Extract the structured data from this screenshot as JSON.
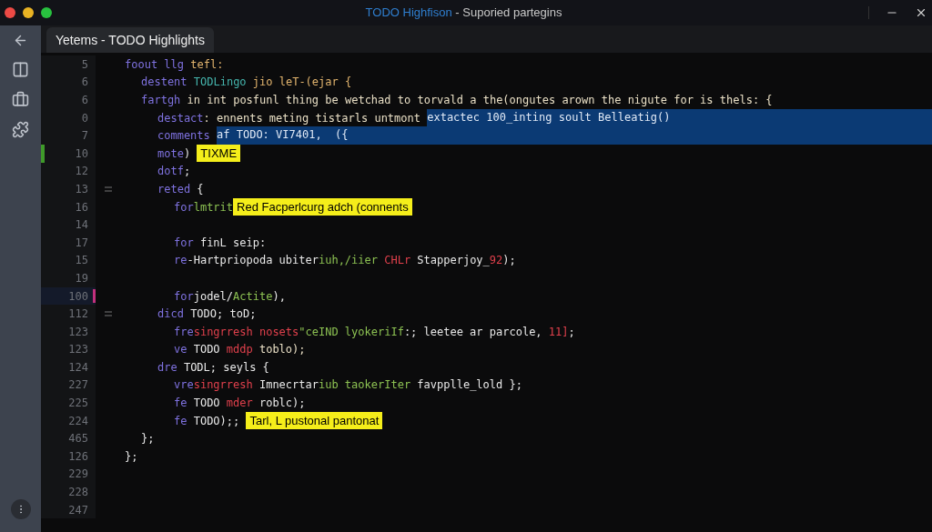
{
  "window": {
    "title_app": "TODO Highfison",
    "title_rest": " - Suporied partegins"
  },
  "tab": {
    "label": "Yetems - TODO Highlights",
    "selected": true
  },
  "lines": [
    {
      "number": "5",
      "fold": false,
      "added": false,
      "current": false,
      "segments": [
        {
          "kind": "keyword",
          "text": "foout llg"
        },
        {
          "kind": "orange",
          "text": " tefl:"
        }
      ],
      "children": [
        {
          "number": "6",
          "fold": false,
          "added": false,
          "current": false,
          "segments": [
            {
              "kind": "keyword",
              "text": "destent "
            },
            {
              "kind": "func",
              "text": "TODLingo"
            },
            {
              "kind": "orange",
              "text": " jio leT-(ejar {"
            }
          ]
        },
        {
          "number": "6",
          "fold": false,
          "added": false,
          "current": false,
          "segments": [
            {
              "kind": "keyword",
              "text": "fartgh"
            },
            {
              "kind": "beige",
              "text": " in int posfunl thing be wetchad to torvald a the(ongutes arown the nigute for is thels: {"
            }
          ],
          "children": [
            {
              "number": "0",
              "fold": false,
              "added": false,
              "current": false,
              "segments": [
                {
                  "kind": "keyword",
                  "text": "destact"
                },
                {
                  "kind": "beige",
                  "text": ": ennents meting tistarls untmont "
                },
                {
                  "kind": "selection",
                  "text": "extactec 100_inting soult Belleatig()"
                }
              ]
            },
            {
              "number": "7",
              "fold": false,
              "added": false,
              "current": false,
              "segments": [
                {
                  "kind": "keyword",
                  "text": "comments "
                },
                {
                  "kind": "selection",
                  "text": "af TODO: VI7401,  ({"
                }
              ]
            },
            {
              "number": "10",
              "fold": false,
              "added": true,
              "current": false,
              "segments": [
                {
                  "kind": "keyword",
                  "text": "mote"
                },
                {
                  "kind": "plain",
                  "text": ") "
                },
                {
                  "kind": "highlight",
                  "text": "TIXME"
                }
              ]
            },
            {
              "number": "12",
              "fold": false,
              "added": false,
              "current": false,
              "segments": [
                {
                  "kind": "keyword",
                  "text": "dotf"
                },
                {
                  "kind": "plain",
                  "text": ";"
                }
              ]
            },
            {
              "number": "13",
              "fold": true,
              "added": false,
              "current": false,
              "segments": [
                {
                  "kind": "keyword",
                  "text": "reted"
                },
                {
                  "kind": "plain",
                  "text": " {"
                }
              ],
              "children": [
                {
                  "number": "16",
                  "fold": false,
                  "added": false,
                  "current": false,
                  "segments": [
                    {
                      "kind": "keyword",
                      "text": "for"
                    },
                    {
                      "kind": "type",
                      "text": "lmtrit"
                    },
                    {
                      "kind": "highlight",
                      "text": "Red Facperlcurg adch (connents"
                    }
                  ]
                },
                {
                  "number": "14",
                  "fold": false,
                  "added": false,
                  "current": false
                },
                {
                  "number": "17",
                  "fold": false,
                  "added": false,
                  "current": false,
                  "segments": [
                    {
                      "kind": "keyword",
                      "text": "for"
                    },
                    {
                      "kind": "plain",
                      "text": " finL seip:"
                    }
                  ]
                },
                {
                  "number": "15",
                  "fold": false,
                  "added": false,
                  "current": false,
                  "segments": [
                    {
                      "kind": "keyword",
                      "text": "re"
                    },
                    {
                      "kind": "plain",
                      "text": "-Hartpriopoda ubiter"
                    },
                    {
                      "kind": "type",
                      "text": "iuh,/iier "
                    },
                    {
                      "kind": "string",
                      "text": "CHLr"
                    },
                    {
                      "kind": "plain",
                      "text": " Stapperjoy_"
                    },
                    {
                      "kind": "string",
                      "text": "92"
                    },
                    {
                      "kind": "plain",
                      "text": ");"
                    }
                  ]
                },
                {
                  "number": "19",
                  "fold": false,
                  "added": false,
                  "current": false
                },
                {
                  "number": "100",
                  "fold": false,
                  "added": false,
                  "current": true,
                  "segments": [
                    {
                      "kind": "keyword",
                      "text": "for"
                    },
                    {
                      "kind": "plain",
                      "text": "jodel/"
                    },
                    {
                      "kind": "type",
                      "text": "Actite"
                    },
                    {
                      "kind": "plain",
                      "text": "),"
                    }
                  ]
                }
              ]
            },
            {
              "number": "112",
              "fold": true,
              "added": false,
              "current": false,
              "segments": [
                {
                  "kind": "keyword",
                  "text": "dicd"
                },
                {
                  "kind": "plain",
                  "text": " TODO; toD;"
                }
              ],
              "children": [
                {
                  "number": "123",
                  "fold": false,
                  "added": false,
                  "current": false,
                  "segments": [
                    {
                      "kind": "keyword",
                      "text": "fre"
                    },
                    {
                      "kind": "string",
                      "text": "singrresh nosets"
                    },
                    {
                      "kind": "type",
                      "text": "\"ceIND lyokeriIf"
                    },
                    {
                      "kind": "plain",
                      "text": ":; leetee ar parcole, "
                    },
                    {
                      "kind": "string",
                      "text": "11]"
                    },
                    {
                      "kind": "plain",
                      "text": ";"
                    }
                  ]
                },
                {
                  "number": "123",
                  "fold": false,
                  "added": false,
                  "current": false,
                  "segments": [
                    {
                      "kind": "keyword",
                      "text": "ve"
                    },
                    {
                      "kind": "plain",
                      "text": " TODO "
                    },
                    {
                      "kind": "string",
                      "text": "mddp"
                    },
                    {
                      "kind": "beige",
                      "text": " toblo);"
                    }
                  ]
                }
              ]
            },
            {
              "number": "124",
              "fold": false,
              "added": false,
              "current": false,
              "segments": [
                {
                  "kind": "keyword",
                  "text": "dre"
                },
                {
                  "kind": "plain",
                  "text": " TODL; seyls {"
                }
              ],
              "children": [
                {
                  "number": "227",
                  "fold": false,
                  "added": false,
                  "current": false,
                  "segments": [
                    {
                      "kind": "keyword",
                      "text": "vre"
                    },
                    {
                      "kind": "string",
                      "text": "singrresh"
                    },
                    {
                      "kind": "plain",
                      "text": " Imnecrtar"
                    },
                    {
                      "kind": "type",
                      "text": "iub taokerIter"
                    },
                    {
                      "kind": "plain",
                      "text": " favpplle_lold };"
                    }
                  ]
                },
                {
                  "number": "225",
                  "fold": false,
                  "added": false,
                  "current": false,
                  "segments": [
                    {
                      "kind": "keyword",
                      "text": "fe"
                    },
                    {
                      "kind": "plain",
                      "text": " TODO "
                    },
                    {
                      "kind": "string",
                      "text": "mder"
                    },
                    {
                      "kind": "plain",
                      "text": " roblc);"
                    }
                  ]
                },
                {
                  "number": "224",
                  "fold": false,
                  "added": false,
                  "current": false,
                  "segments": [
                    {
                      "kind": "keyword",
                      "text": "fe"
                    },
                    {
                      "kind": "plain",
                      "text": " TODO);; "
                    },
                    {
                      "kind": "highlight",
                      "text": "Tarl, L pustonal pantonat"
                    }
                  ]
                }
              ]
            }
          ]
        },
        {
          "number": "465",
          "fold": false,
          "added": false,
          "current": false,
          "segments": [
            {
              "kind": "plain",
              "text": "};"
            }
          ]
        }
      ]
    },
    {
      "number": "126",
      "fold": false,
      "added": false,
      "current": false,
      "segments": [
        {
          "kind": "plain",
          "text": "};"
        }
      ]
    },
    {
      "number": "229",
      "fold": false,
      "added": false,
      "current": false
    },
    {
      "number": "228",
      "fold": false,
      "added": false,
      "current": false
    },
    {
      "number": "247",
      "fold": false,
      "added": false,
      "current": false
    }
  ]
}
